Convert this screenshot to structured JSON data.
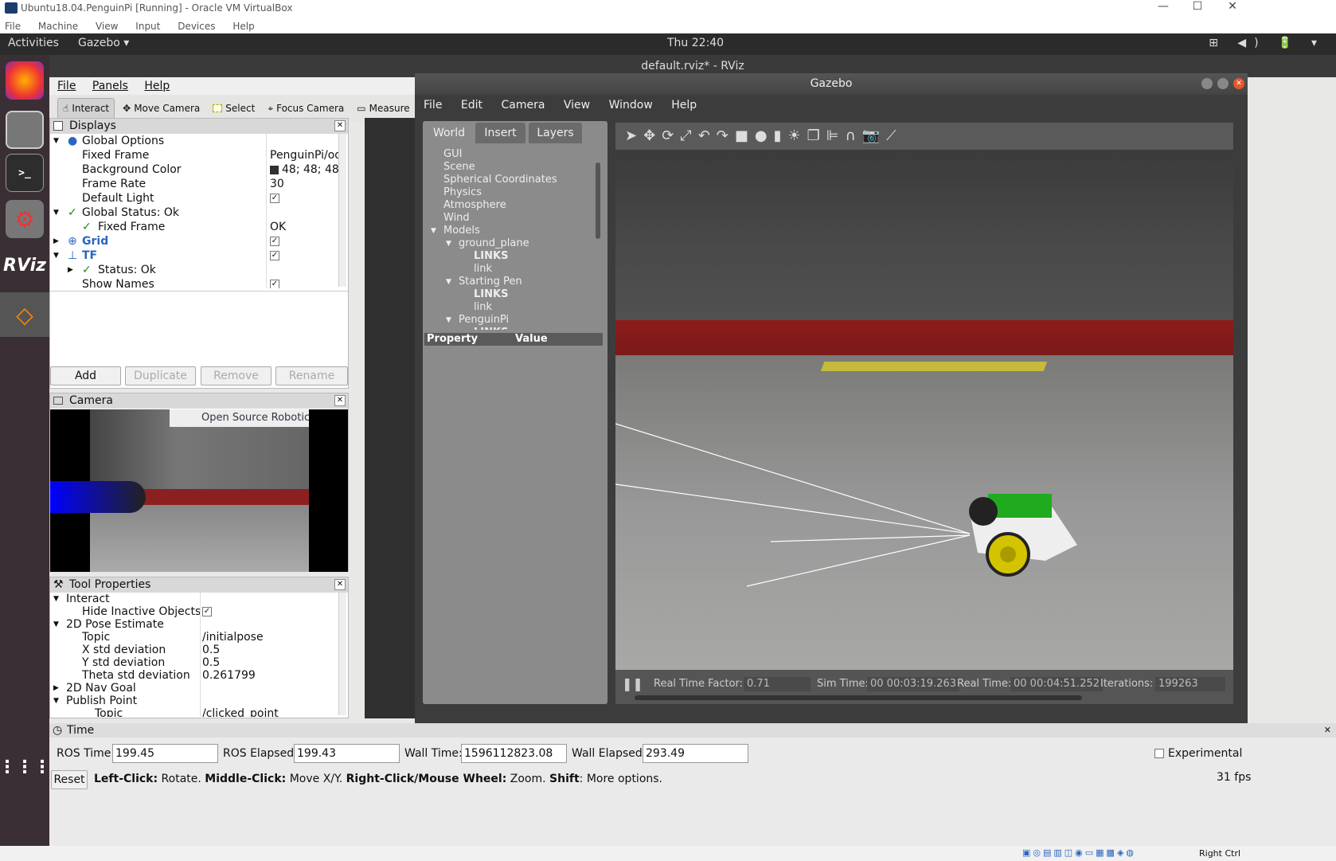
{
  "vbox": {
    "title": "Ubuntu18.04.PenguinPi [Running] - Oracle VM VirtualBox",
    "menu": [
      "File",
      "Machine",
      "View",
      "Input",
      "Devices",
      "Help"
    ]
  },
  "ubuntu": {
    "activities": "Activities",
    "app": "Gazebo ▾",
    "clock": "Thu 22:40",
    "tray": "⊞ ◀) 🔋 ▾"
  },
  "dock": {
    "items": [
      "firefox-icon",
      "files-icon",
      "terminal-icon",
      "settings-icon",
      "rviz-icon",
      "gazebo-icon"
    ],
    "rviz_label": "RViz",
    "apps": "⋮⋮⋮"
  },
  "rviz": {
    "title": "default.rviz* - RViz",
    "menu": [
      "File",
      "Panels",
      "Help"
    ],
    "toolbar": [
      "Interact",
      "Move Camera",
      "Select",
      "Focus Camera",
      "Measure"
    ],
    "displays": {
      "title": "Displays",
      "rows": [
        {
          "n": "Global Options",
          "v": ""
        },
        {
          "n": "Fixed Frame",
          "v": "PenguinPi/od."
        },
        {
          "n": "Background Color",
          "v": "48; 48; 48"
        },
        {
          "n": "Frame Rate",
          "v": "30"
        },
        {
          "n": "Default Light",
          "v": "✓"
        },
        {
          "n": "Global Status: Ok",
          "v": ""
        },
        {
          "n": "Fixed Frame",
          "v": "OK"
        },
        {
          "n": "Grid",
          "v": "✓"
        },
        {
          "n": "TF",
          "v": "✓"
        },
        {
          "n": "Status: Ok",
          "v": ""
        },
        {
          "n": "Show Names",
          "v": "✓"
        }
      ],
      "buttons": [
        "Add",
        "Duplicate",
        "Remove",
        "Rename"
      ]
    },
    "camera": {
      "title": "Camera",
      "banner": "Open Source Robotics"
    },
    "tool": {
      "title": "Tool Properties",
      "rows": [
        {
          "n": "Interact",
          "v": ""
        },
        {
          "n": "Hide Inactive Objects",
          "v": "✓"
        },
        {
          "n": "2D Pose Estimate",
          "v": ""
        },
        {
          "n": "Topic",
          "v": "/initialpose"
        },
        {
          "n": "X std deviation",
          "v": "0.5"
        },
        {
          "n": "Y std deviation",
          "v": "0.5"
        },
        {
          "n": "Theta std deviation",
          "v": "0.261799"
        },
        {
          "n": "2D Nav Goal",
          "v": ""
        },
        {
          "n": "Publish Point",
          "v": ""
        },
        {
          "n": "Topic",
          "v": "/clicked_point"
        }
      ]
    },
    "time": {
      "title": "Time",
      "ros_time_label": "ROS Time:",
      "ros_time": "199.45",
      "ros_el_label": "ROS Elapsed:",
      "ros_el": "199.43",
      "wall_label": "Wall Time:",
      "wall": "1596112823.08",
      "wall_el_label": "Wall Elapsed:",
      "wall_el": "293.49",
      "experimental": "Experimental",
      "reset": "Reset",
      "fps": "31 fps",
      "help": [
        {
          "b": "Left-Click:",
          "t": " Rotate. "
        },
        {
          "b": "Middle-Click:",
          "t": " Move X/Y. "
        },
        {
          "b": "Right-Click/Mouse Wheel:",
          "t": " Zoom. "
        },
        {
          "b": "Shift",
          "t": ": More options."
        }
      ]
    }
  },
  "gazebo": {
    "title": "Gazebo",
    "menu": [
      "File",
      "Edit",
      "Camera",
      "View",
      "Window",
      "Help"
    ],
    "tabs": [
      "World",
      "Insert",
      "Layers"
    ],
    "tree": [
      "GUI",
      "Scene",
      "Spherical Coordinates",
      "Physics",
      "Atmosphere",
      "Wind",
      "Models",
      "ground_plane",
      "LINKS",
      "link",
      "Starting Pen",
      "LINKS",
      "link",
      "PenguinPi",
      "LINKS"
    ],
    "prop_header": "Property",
    "value_header": "Value",
    "status": {
      "rtf_label": "Real Time Factor:",
      "rtf": "0.71",
      "sim_label": "Sim Time:",
      "sim": "00 00:03:19.263",
      "real_label": "Real Time:",
      "real": "00 00:04:51.252",
      "iter_label": "Iterations:",
      "iter": "199263"
    }
  },
  "taskbar": {
    "right_ctrl": "Right Ctrl"
  }
}
